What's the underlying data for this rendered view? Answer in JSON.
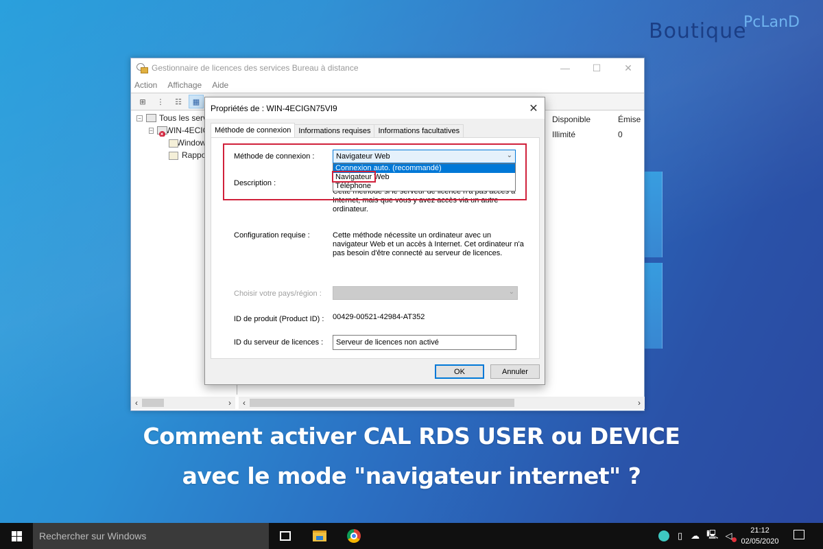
{
  "brand": {
    "part1": "Boutique",
    "part2": "PcLanD"
  },
  "mmc": {
    "title": "Gestionnaire de licences des services Bureau à distance",
    "window_controls": {
      "minimize": "—",
      "maximize": "☐",
      "close": "✕"
    },
    "menu": [
      "Action",
      "Affichage",
      "Aide"
    ],
    "toolbar_icons": [
      "tree-view-icon",
      "list-view-icon",
      "details-view-icon",
      "grid-view-icon"
    ],
    "tree": [
      {
        "label": "Tous les serveurs",
        "level": 0,
        "expander": "−"
      },
      {
        "label": "WIN-4ECIGN75VI9",
        "level": 1,
        "expander": "−"
      },
      {
        "label": "Windows Server",
        "level": 2
      },
      {
        "label": "Rapports",
        "level": 2
      }
    ],
    "list": {
      "columns": [
        "Disponible",
        "Émise"
      ],
      "rows": [
        [
          "Illimité",
          "0"
        ]
      ]
    },
    "scroll_arrows": {
      "left": "‹",
      "right": "›"
    }
  },
  "dialog": {
    "title": "Propriétés de : WIN-4ECIGN75VI9",
    "close": "✕",
    "tabs": [
      "Méthode de connexion",
      "Informations requises",
      "Informations facultatives"
    ],
    "active_tab": 0,
    "method_label": "Méthode de connexion :",
    "method_value": "Navigateur Web",
    "method_options": [
      "Connexion auto. (recommandé)",
      "Navigateur Web",
      "Téléphone"
    ],
    "method_highlighted_option": "Connexion auto. (recommandé)",
    "description_label": "Description :",
    "description_text": "Cette méthode si le serveur de licence n'a pas accès à Internet, mais que vous y avez accès via un autre ordinateur.",
    "config_label": "Configuration requise :",
    "config_text": "Cette méthode nécessite un ordinateur avec un navigateur Web et un accès à Internet. Cet ordinateur n'a pas besoin d'être connecté au serveur de licences.",
    "country_label": "Choisir votre pays/région :",
    "country_value": "",
    "product_id_label": "ID de produit (Product ID) :",
    "product_id_value": "00429-00521-42984-AT352",
    "server_id_label": "ID du serveur de licences :",
    "server_id_value": "Serveur de licences non activé",
    "ok_label": "OK",
    "cancel_label": "Annuler",
    "chevron": "⌄"
  },
  "caption": {
    "line1": "Comment activer CAL RDS USER ou DEVICE",
    "line2": "avec le mode \"navigateur internet\" ?"
  },
  "taskbar": {
    "search_placeholder": "Rechercher sur Windows",
    "pinned": [
      "task-view",
      "file-explorer",
      "chrome"
    ],
    "time": "21:12",
    "date": "02/05/2020"
  },
  "colors": {
    "highlight_red": "#d0203a",
    "selection_blue": "#0078d7",
    "caption_text": "#ffffff"
  }
}
